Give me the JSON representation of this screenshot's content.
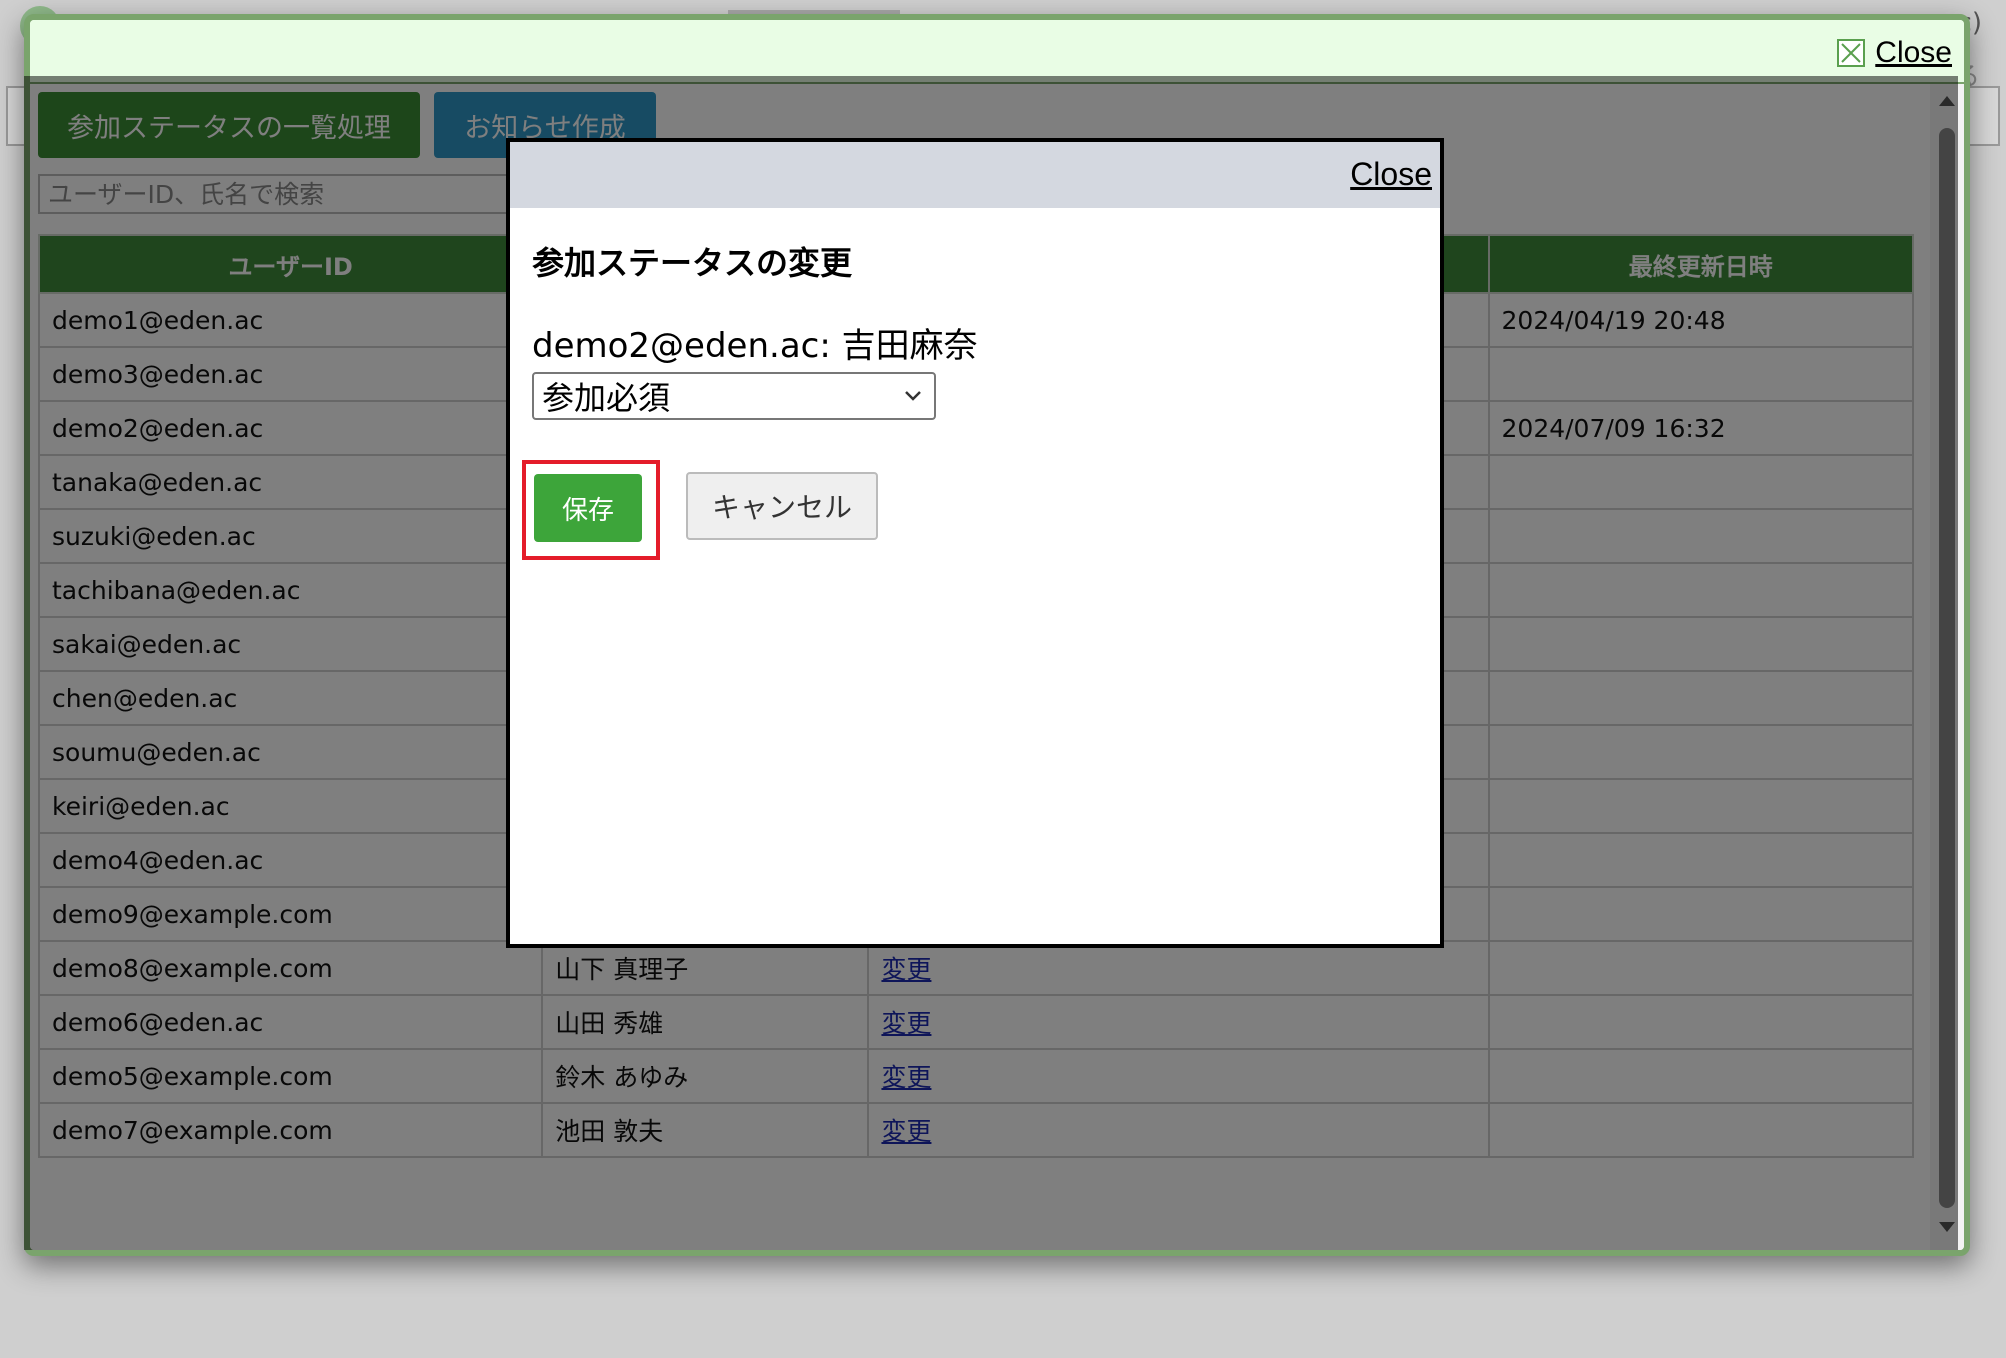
{
  "background": {
    "header_text": "c)",
    "header_text2": "る"
  },
  "outer": {
    "close_label": "Close",
    "bulk_button": "参加ステータスの一覧処理",
    "notice_button": "お知らせ作成",
    "search_placeholder": "ユーザーID、氏名で検索",
    "table": {
      "headers": [
        "ユーザーID",
        "",
        "",
        "最終更新日時"
      ],
      "rows": [
        {
          "id": "demo1@eden.ac",
          "name": "",
          "change": "",
          "date": "2024/04/19 20:48"
        },
        {
          "id": "demo3@eden.ac",
          "name": "",
          "change": "",
          "date": ""
        },
        {
          "id": "demo2@eden.ac",
          "name": "",
          "change": "",
          "date": "2024/07/09 16:32"
        },
        {
          "id": "tanaka@eden.ac",
          "name": "",
          "change": "",
          "date": ""
        },
        {
          "id": "suzuki@eden.ac",
          "name": "",
          "change": "",
          "date": ""
        },
        {
          "id": "tachibana@eden.ac",
          "name": "",
          "change": "",
          "date": ""
        },
        {
          "id": "sakai@eden.ac",
          "name": "",
          "change": "",
          "date": ""
        },
        {
          "id": "chen@eden.ac",
          "name": "",
          "change": "",
          "date": ""
        },
        {
          "id": "soumu@eden.ac",
          "name": "",
          "change": "",
          "date": ""
        },
        {
          "id": "keiri@eden.ac",
          "name": "",
          "change": "",
          "date": ""
        },
        {
          "id": "demo4@eden.ac",
          "name": "",
          "change": "",
          "date": ""
        },
        {
          "id": "demo9@example.com",
          "name": "",
          "change": "",
          "date": ""
        },
        {
          "id": "demo8@example.com",
          "name": "山下 真理子",
          "change": "変更",
          "date": ""
        },
        {
          "id": "demo6@eden.ac",
          "name": "山田 秀雄",
          "change": "変更",
          "date": ""
        },
        {
          "id": "demo5@example.com",
          "name": "鈴木 あゆみ",
          "change": "変更",
          "date": ""
        },
        {
          "id": "demo7@example.com",
          "name": "池田 敦夫",
          "change": "変更",
          "date": ""
        }
      ]
    }
  },
  "dialog": {
    "close_label": "Close",
    "title": "参加ステータスの変更",
    "user_line": "demo2@eden.ac: 吉田麻奈",
    "status_selected": "参加必須",
    "save_label": "保存",
    "cancel_label": "キャンセル"
  },
  "colors": {
    "green": "#3f8a3a",
    "blue": "#2f97c7",
    "highlight": "#e41c2a"
  }
}
